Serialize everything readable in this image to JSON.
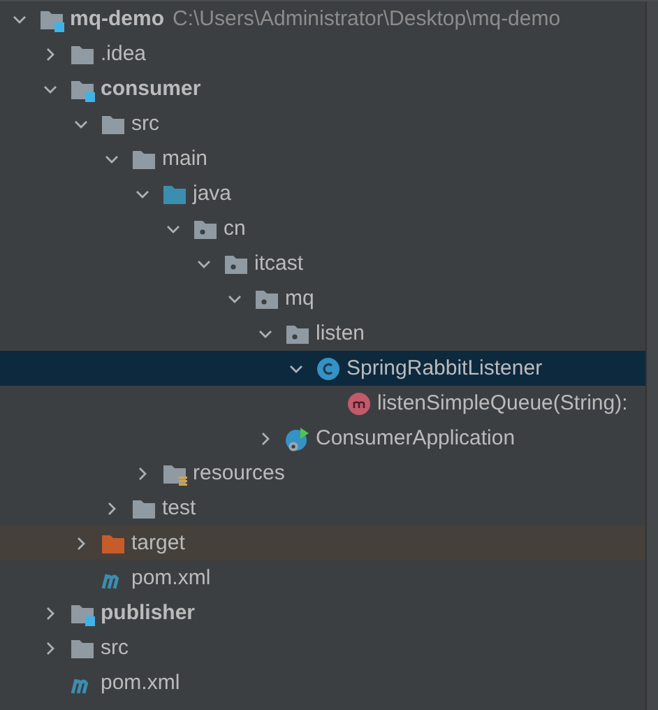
{
  "tree": [
    {
      "label": "mq-demo",
      "path": "C:\\Users\\Administrator\\Desktop\\mq-demo",
      "kind": "module",
      "expanded": true,
      "selected": false,
      "children": [
        {
          "label": ".idea",
          "kind": "folder",
          "expanded": false,
          "selected": false
        },
        {
          "label": "consumer",
          "kind": "module",
          "expanded": true,
          "selected": false,
          "children": [
            {
              "label": "src",
              "kind": "folder",
              "expanded": true,
              "selected": false,
              "children": [
                {
                  "label": "main",
                  "kind": "folder",
                  "expanded": true,
                  "selected": false,
                  "children": [
                    {
                      "label": "java",
                      "kind": "source-root",
                      "expanded": true,
                      "selected": false,
                      "children": [
                        {
                          "label": "cn",
                          "kind": "package",
                          "expanded": true,
                          "selected": false,
                          "children": [
                            {
                              "label": "itcast",
                              "kind": "package",
                              "expanded": true,
                              "selected": false,
                              "children": [
                                {
                                  "label": "mq",
                                  "kind": "package",
                                  "expanded": true,
                                  "selected": false,
                                  "children": [
                                    {
                                      "label": "listen",
                                      "kind": "package",
                                      "expanded": true,
                                      "selected": false,
                                      "children": [
                                        {
                                          "label": "SpringRabbitListener",
                                          "kind": "class",
                                          "expanded": true,
                                          "selected": true,
                                          "children": [
                                            {
                                              "label": "listenSimpleQueue(String):",
                                              "kind": "method",
                                              "selected": false
                                            }
                                          ]
                                        }
                                      ]
                                    },
                                    {
                                      "label": "ConsumerApplication",
                                      "kind": "spring-app",
                                      "expanded": false,
                                      "selected": false
                                    }
                                  ]
                                }
                              ]
                            }
                          ]
                        }
                      ]
                    },
                    {
                      "label": "resources",
                      "kind": "resources",
                      "expanded": false,
                      "selected": false
                    }
                  ]
                },
                {
                  "label": "test",
                  "kind": "folder",
                  "expanded": false,
                  "selected": false
                }
              ]
            },
            {
              "label": "target",
              "kind": "excluded",
              "expanded": false,
              "selected": false
            },
            {
              "label": "pom.xml",
              "kind": "maven",
              "selected": false
            }
          ]
        },
        {
          "label": "publisher",
          "kind": "module",
          "expanded": false,
          "selected": false
        },
        {
          "label": "src",
          "kind": "folder",
          "expanded": false,
          "selected": false
        },
        {
          "label": "pom.xml",
          "kind": "maven",
          "selected": false
        }
      ]
    }
  ]
}
